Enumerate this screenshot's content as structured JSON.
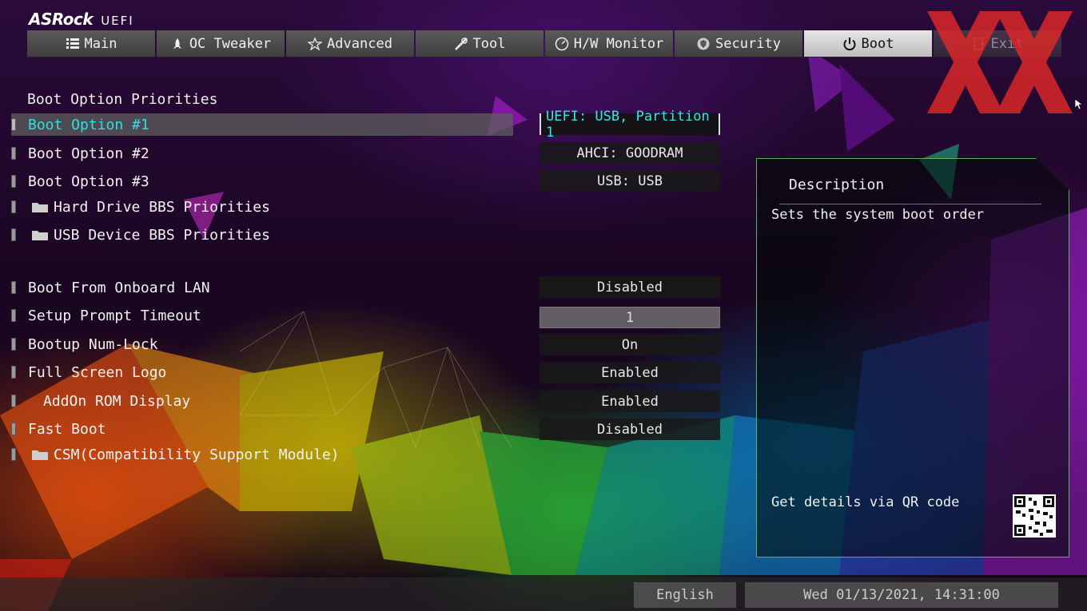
{
  "header": {
    "brand": "ASRock",
    "brand_suffix": "UEFI",
    "tabs": [
      {
        "label": "Main",
        "icon": "list-icon"
      },
      {
        "label": "OC Tweaker",
        "icon": "rocket-icon"
      },
      {
        "label": "Advanced",
        "icon": "star-icon"
      },
      {
        "label": "Tool",
        "icon": "wrench-icon"
      },
      {
        "label": "H/W Monitor",
        "icon": "gauge-icon"
      },
      {
        "label": "Security",
        "icon": "shield-icon"
      },
      {
        "label": "Boot",
        "icon": "power-icon"
      },
      {
        "label": "Exit",
        "icon": "exit-icon"
      }
    ],
    "active_tab": "Boot"
  },
  "boot": {
    "section_title": "Boot Option Priorities",
    "items": [
      {
        "label": "Boot Option #1",
        "value": "UEFI:  USB, Partition 1"
      },
      {
        "label": "Boot Option #2",
        "value": "AHCI:  GOODRAM"
      },
      {
        "label": "Boot Option #3",
        "value": "USB:  USB"
      },
      {
        "label": "Hard Drive BBS Priorities"
      },
      {
        "label": "USB Device BBS Priorities"
      },
      {
        "label": "Boot From Onboard LAN",
        "value": "Disabled"
      },
      {
        "label": "Setup Prompt Timeout",
        "value": "1"
      },
      {
        "label": "Bootup Num-Lock",
        "value": "On"
      },
      {
        "label": "Full Screen Logo",
        "value": "Enabled"
      },
      {
        "label": "AddOn ROM Display",
        "value": "Enabled"
      },
      {
        "label": "Fast Boot",
        "value": "Disabled"
      },
      {
        "label": "CSM(Compatibility Support Module)"
      }
    ]
  },
  "description": {
    "title": "Description",
    "text": "Sets the system boot order",
    "qr_label": "Get details via QR code"
  },
  "footer": {
    "language": "English",
    "datetime": "Wed 01/13/2021, 14:31:00"
  },
  "colors": {
    "selected_text": "#36e6e6",
    "panel_border": "#5fb05f",
    "watermark": "#e02828"
  }
}
